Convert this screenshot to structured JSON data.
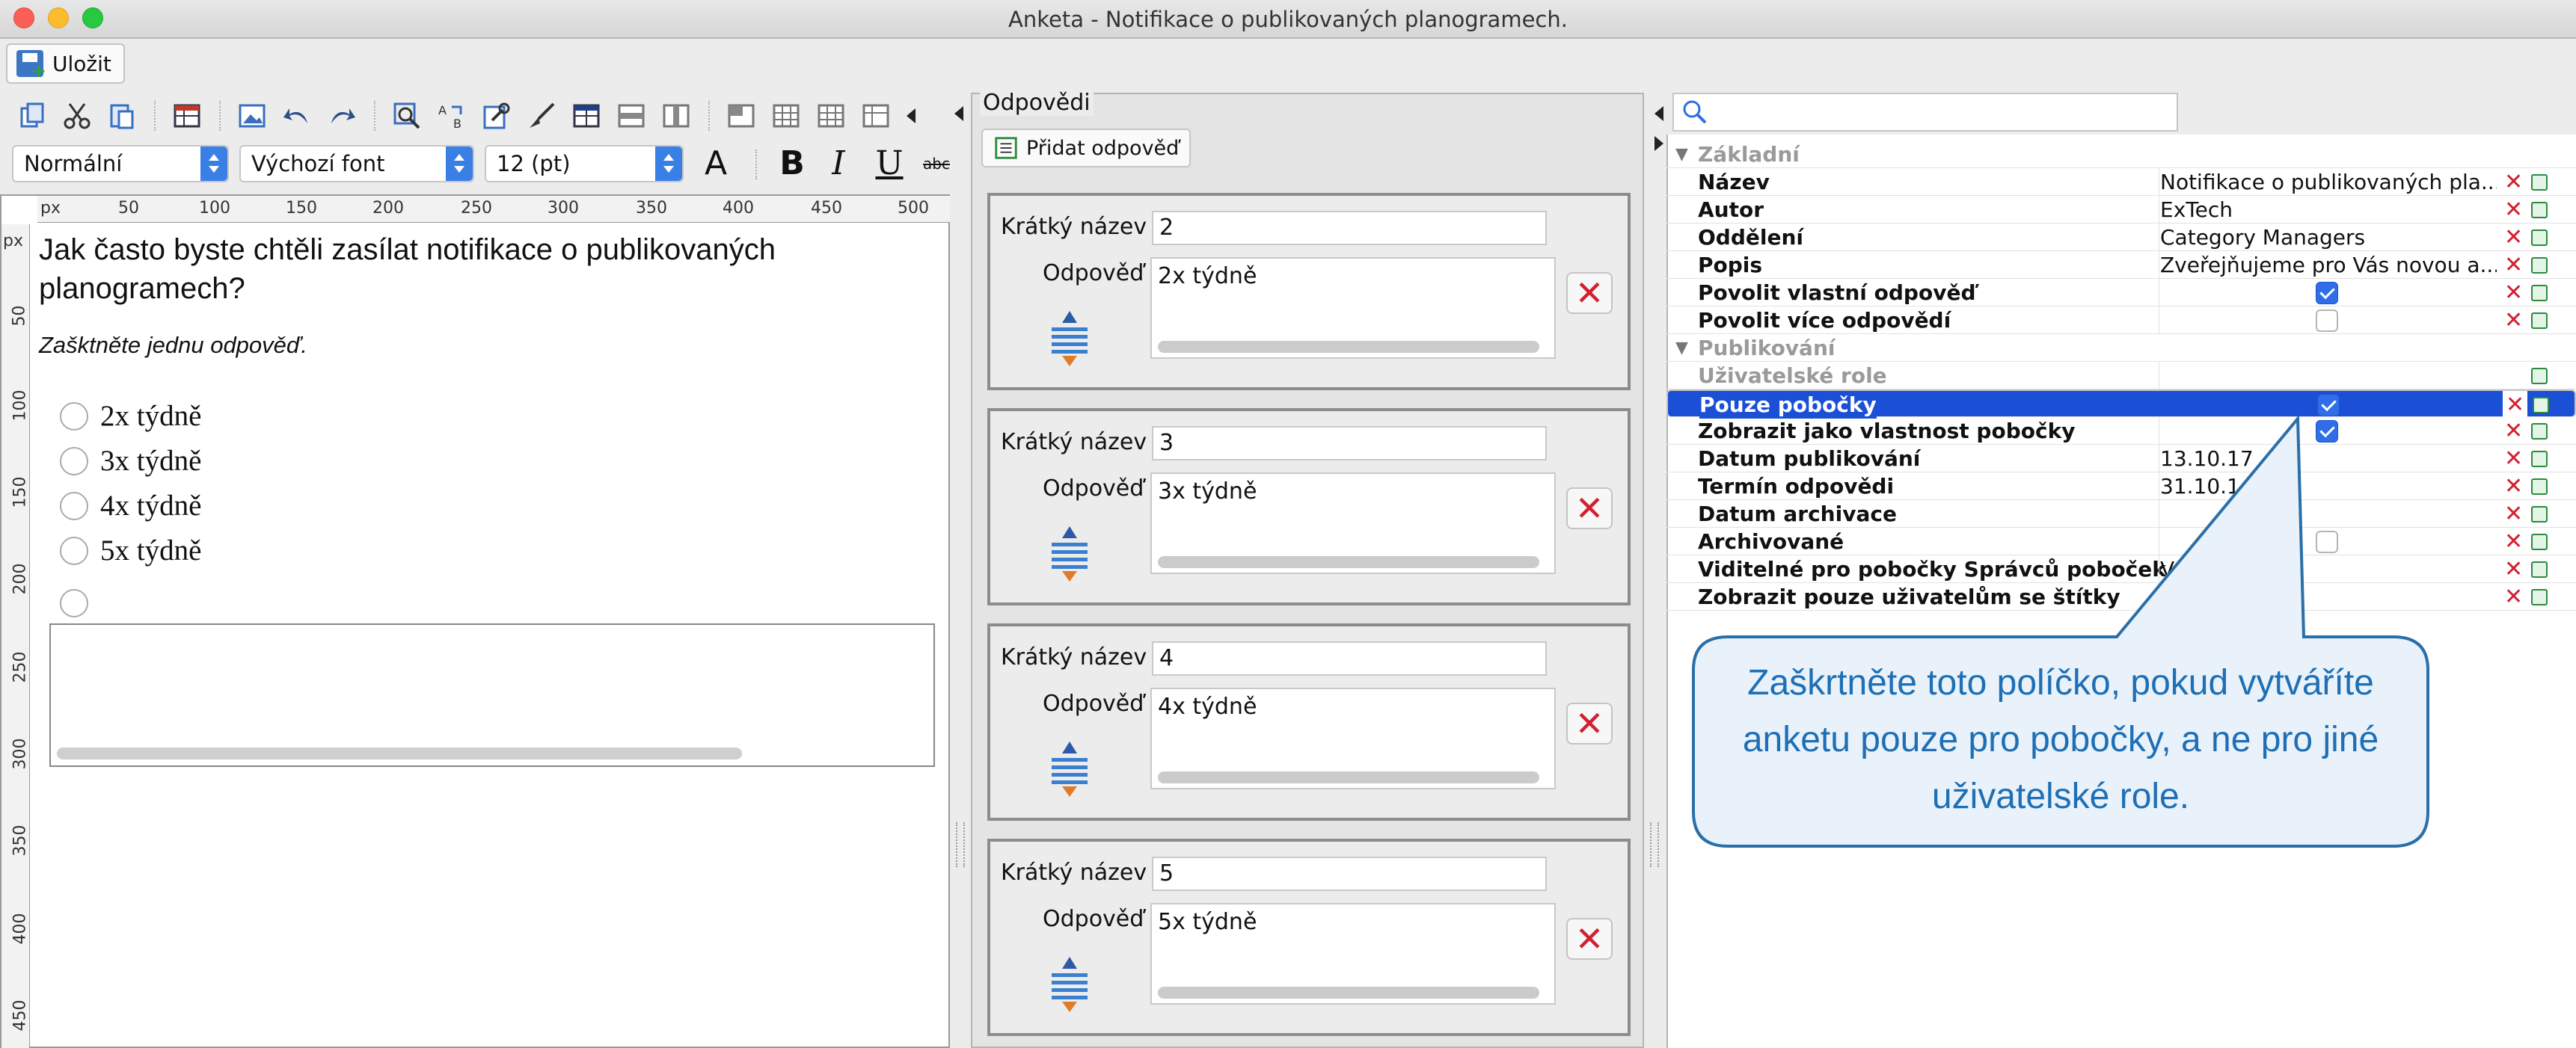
{
  "window": {
    "title": "Anketa - Notifikace o publikovaných planogramech."
  },
  "toolbar": {
    "save_label": "Uložit"
  },
  "format": {
    "style": "Normální",
    "font": "Výchozí font",
    "size": "12 (pt)",
    "font_color_label": "A",
    "bold_label": "B",
    "italic_label": "I",
    "underline_label": "U",
    "strike_label": "abc"
  },
  "ruler": {
    "unit": "px",
    "h_ticks": [
      "50",
      "100",
      "150",
      "200",
      "250",
      "300",
      "350",
      "400",
      "450",
      "500"
    ],
    "v_ticks": [
      "50",
      "100",
      "150",
      "200",
      "250",
      "300",
      "350",
      "400",
      "450"
    ]
  },
  "question": {
    "text": "Jak často byste chtěli zasílat notifikace o publikovaných planogramech?",
    "hint": "Zašktněte jednu odpověď.",
    "options": [
      "2x týdně",
      "3x týdně",
      "4x týdně",
      "5x týdně"
    ]
  },
  "answers": {
    "title": "Odpovědi",
    "add_label": "Přidat odpověď",
    "short_name_label": "Krátký název",
    "answer_label": "Odpověď",
    "items": [
      {
        "short": "2",
        "text": "2x týdně"
      },
      {
        "short": "3",
        "text": "3x týdně"
      },
      {
        "short": "4",
        "text": "4x týdně"
      },
      {
        "short": "5",
        "text": "5x týdně"
      }
    ]
  },
  "props": {
    "cat_basic": "Základní",
    "cat_publish": "Publikování",
    "rows": {
      "nazev": {
        "name": "Název",
        "value": "Notifikace o publikovaných pla..."
      },
      "autor": {
        "name": "Autor",
        "value": "ExTech"
      },
      "oddeleni": {
        "name": "Oddělení",
        "value": "Category Managers"
      },
      "popis": {
        "name": "Popis",
        "value": "Zveřejňujeme pro Vás novou a..."
      },
      "povolit_vlastni": {
        "name": "Povolit vlastní odpověď",
        "checked": true
      },
      "povolit_vice": {
        "name": "Povolit více odpovědí",
        "checked": false
      },
      "uziv_role": {
        "name": "Uživatelské role"
      },
      "pouze_pobocky": {
        "name": "Pouze pobočky",
        "checked": true
      },
      "zobrazit_vlastnost": {
        "name": "Zobrazit jako vlastnost pobočky",
        "checked": true
      },
      "datum_publ": {
        "name": "Datum publikování",
        "value": "13.10.17 ... 0"
      },
      "termin": {
        "name": "Termín odpovědi",
        "value": "31.10.1 ... 0"
      },
      "datum_arch": {
        "name": "Datum archivace",
        "value": ""
      },
      "archivovane": {
        "name": "Archivované",
        "checked": false
      },
      "viditelne": {
        "name": "Viditelné pro pobočky Správců poboček",
        "value": "V ... čky"
      },
      "zobrazit_stitky": {
        "name": "Zobrazit pouze uživatelům se štítky",
        "value": ""
      }
    }
  },
  "callout": {
    "text": "Zaškrtněte toto políčko, pokud vytváříte anketu pouze pro pobočky, a ne pro jiné uživatelské role."
  },
  "colors": {
    "accent": "#1a4fd6",
    "delete": "#d22030",
    "callout": "#1e6fb5"
  }
}
